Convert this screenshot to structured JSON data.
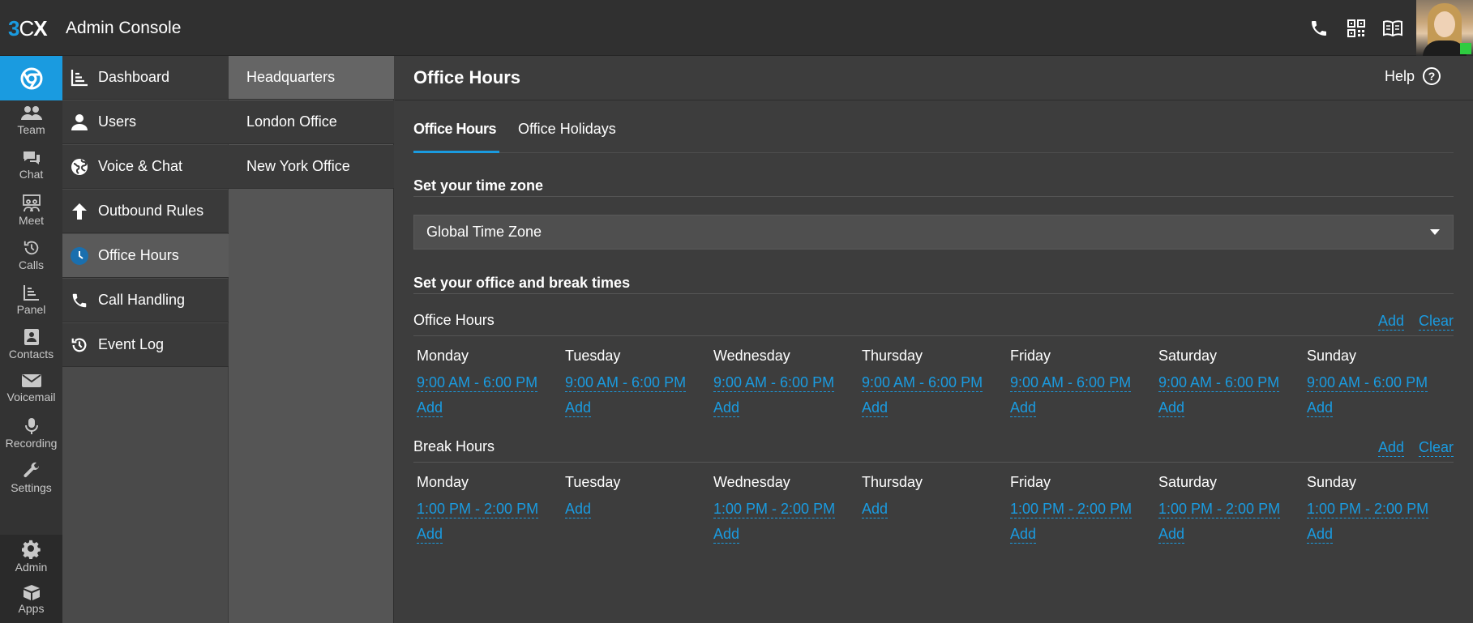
{
  "header": {
    "logo": {
      "three": "3",
      "c": "C",
      "x": "X"
    },
    "title": "Admin Console",
    "icons": [
      "phone-icon",
      "qr-code-icon",
      "book-icon"
    ]
  },
  "rail": {
    "items": [
      {
        "label": "Team",
        "icon": "team-icon"
      },
      {
        "label": "Chat",
        "icon": "chat-icon"
      },
      {
        "label": "Meet",
        "icon": "meet-icon"
      },
      {
        "label": "Calls",
        "icon": "history-icon"
      },
      {
        "label": "Panel",
        "icon": "panel-icon"
      },
      {
        "label": "Contacts",
        "icon": "contacts-icon"
      },
      {
        "label": "Voicemail",
        "icon": "voicemail-icon"
      },
      {
        "label": "Recording",
        "icon": "microphone-icon"
      },
      {
        "label": "Settings",
        "icon": "wrench-icon"
      }
    ],
    "bottom": [
      {
        "label": "Admin",
        "icon": "gear-icon"
      },
      {
        "label": "Apps",
        "icon": "box-icon"
      }
    ]
  },
  "menu": {
    "items": [
      {
        "label": "Dashboard",
        "icon": "chart-icon"
      },
      {
        "label": "Users",
        "icon": "user-icon"
      },
      {
        "label": "Voice & Chat",
        "icon": "globe-icon"
      },
      {
        "label": "Outbound Rules",
        "icon": "arrow-up-icon"
      },
      {
        "label": "Office Hours",
        "icon": "clock-icon",
        "active": true
      },
      {
        "label": "Call Handling",
        "icon": "phone-icon"
      },
      {
        "label": "Event Log",
        "icon": "history-icon"
      }
    ]
  },
  "sites": {
    "items": [
      {
        "label": "Headquarters",
        "active": true
      },
      {
        "label": "London Office"
      },
      {
        "label": "New York Office"
      }
    ]
  },
  "main": {
    "title": "Office Hours",
    "help_label": "Help",
    "help_symbol": "?",
    "tabs": [
      {
        "label": "Office Hours",
        "active": true
      },
      {
        "label": "Office Holidays"
      }
    ],
    "timezone_section": "Set your time zone",
    "timezone_value": "Global Time Zone",
    "times_section": "Set your office and break times",
    "office_hours": {
      "label": "Office Hours",
      "add_label": "Add",
      "clear_label": "Clear",
      "days": [
        {
          "name": "Monday",
          "range": "9:00 AM - 6:00 PM",
          "add": "Add"
        },
        {
          "name": "Tuesday",
          "range": "9:00 AM - 6:00 PM",
          "add": "Add"
        },
        {
          "name": "Wednesday",
          "range": "9:00 AM - 6:00 PM",
          "add": "Add"
        },
        {
          "name": "Thursday",
          "range": "9:00 AM - 6:00 PM",
          "add": "Add"
        },
        {
          "name": "Friday",
          "range": "9:00 AM - 6:00 PM",
          "add": "Add"
        },
        {
          "name": "Saturday",
          "range": "9:00 AM - 6:00 PM",
          "add": "Add"
        },
        {
          "name": "Sunday",
          "range": "9:00 AM - 6:00 PM",
          "add": "Add"
        }
      ]
    },
    "break_hours": {
      "label": "Break Hours",
      "add_label": "Add",
      "clear_label": "Clear",
      "days": [
        {
          "name": "Monday",
          "range": "1:00 PM - 2:00 PM",
          "add": "Add"
        },
        {
          "name": "Tuesday",
          "range": "",
          "add": "Add"
        },
        {
          "name": "Wednesday",
          "range": "1:00 PM - 2:00 PM",
          "add": "Add"
        },
        {
          "name": "Thursday",
          "range": "",
          "add": "Add"
        },
        {
          "name": "Friday",
          "range": "1:00 PM - 2:00 PM",
          "add": "Add"
        },
        {
          "name": "Saturday",
          "range": "1:00 PM - 2:00 PM",
          "add": "Add"
        },
        {
          "name": "Sunday",
          "range": "1:00 PM - 2:00 PM",
          "add": "Add"
        }
      ]
    }
  },
  "colors": {
    "accent": "#1a9be0",
    "background": "#3d3d3d",
    "topbar": "#303030",
    "status": "#2ecc40"
  }
}
